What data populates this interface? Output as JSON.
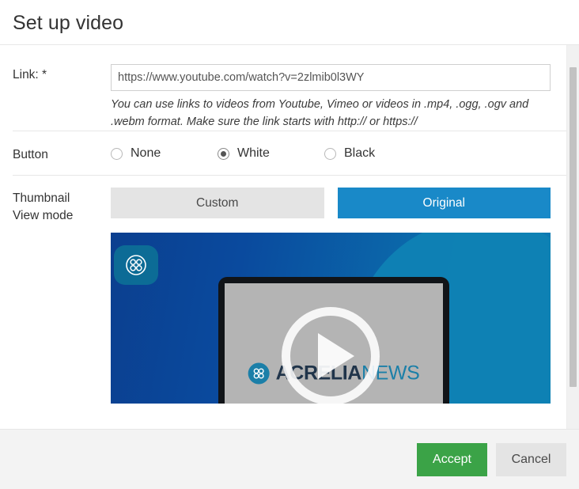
{
  "dialog": {
    "title": "Set up video"
  },
  "link": {
    "label": "Link: *",
    "value": "https://www.youtube.com/watch?v=2zlmib0l3WY",
    "placeholder": "https://",
    "help": "You can use links to videos from Youtube, Vimeo or videos in .mp4, .ogg, .ogv and .webm format. Make sure the link starts with http:// or https://"
  },
  "button": {
    "label": "Button",
    "selected": "White",
    "options": [
      {
        "label": "None",
        "selected": false
      },
      {
        "label": "White",
        "selected": true
      },
      {
        "label": "Black",
        "selected": false
      }
    ]
  },
  "thumbnail": {
    "label_line1": "Thumbnail",
    "label_line2": "View mode",
    "modes": [
      {
        "label": "Custom",
        "active": false
      },
      {
        "label": "Original",
        "active": true
      }
    ],
    "preview": {
      "brand_primary": "ACRELIA",
      "brand_secondary": "NEWS",
      "play_icon": "play-triangle-icon",
      "badge_icon": "acrelia-logo-icon"
    }
  },
  "footer": {
    "accept_label": "Accept",
    "cancel_label": "Cancel"
  },
  "colors": {
    "accent_blue": "#1989c8",
    "accept_green": "#3ba347",
    "neutral_gray": "#e4e4e4",
    "footer_bg": "#f3f3f3",
    "divider": "#e7e7e7",
    "brand_teal": "#1b7fa8",
    "preview_blue_dark": "#0b3f8f",
    "preview_blue_light": "#0d7fb4"
  }
}
